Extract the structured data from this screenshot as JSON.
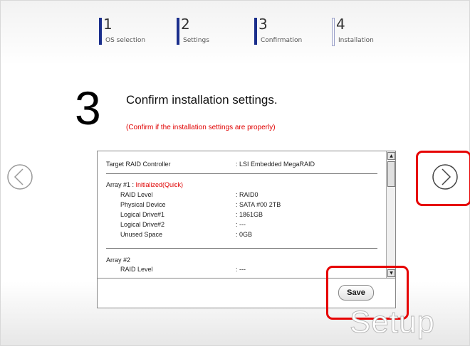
{
  "steps": [
    {
      "num": "1",
      "label": "OS selection"
    },
    {
      "num": "2",
      "label": "Settings"
    },
    {
      "num": "3",
      "label": "Confirmation"
    },
    {
      "num": "4",
      "label": "Installation"
    }
  ],
  "page": {
    "step_number": "3",
    "title": "Confirm installation settings.",
    "subtitle": "(Confirm if the installation settings are properly)"
  },
  "settings": {
    "controller_label": "Target RAID Controller",
    "controller_value": ": LSI Embedded MegaRAID",
    "array1_label": "Array #1",
    "array1_status": "Initialized(Quick)",
    "array1_separator": " : ",
    "array1_rows": [
      {
        "k": "RAID Level",
        "v": ": RAID0"
      },
      {
        "k": "Physical Device",
        "v": ": SATA #00 2TB"
      },
      {
        "k": "Logical Drive#1",
        "v": ": 1861GB"
      },
      {
        "k": "Logical Drive#2",
        "v": ": ---"
      },
      {
        "k": "Unused Space",
        "v": ": 0GB"
      }
    ],
    "array2_label": "Array #2",
    "array2_rows": [
      {
        "k": "RAID Level",
        "v": ": ---"
      }
    ]
  },
  "buttons": {
    "save_label": "Save"
  },
  "watermark": "Setup",
  "colors": {
    "highlight": "#e60000",
    "status_red": "#e00000",
    "step_bar": "#1b2f8c"
  },
  "icons": {
    "prev": "chevron-left-circle-icon",
    "next": "chevron-right-circle-icon"
  }
}
